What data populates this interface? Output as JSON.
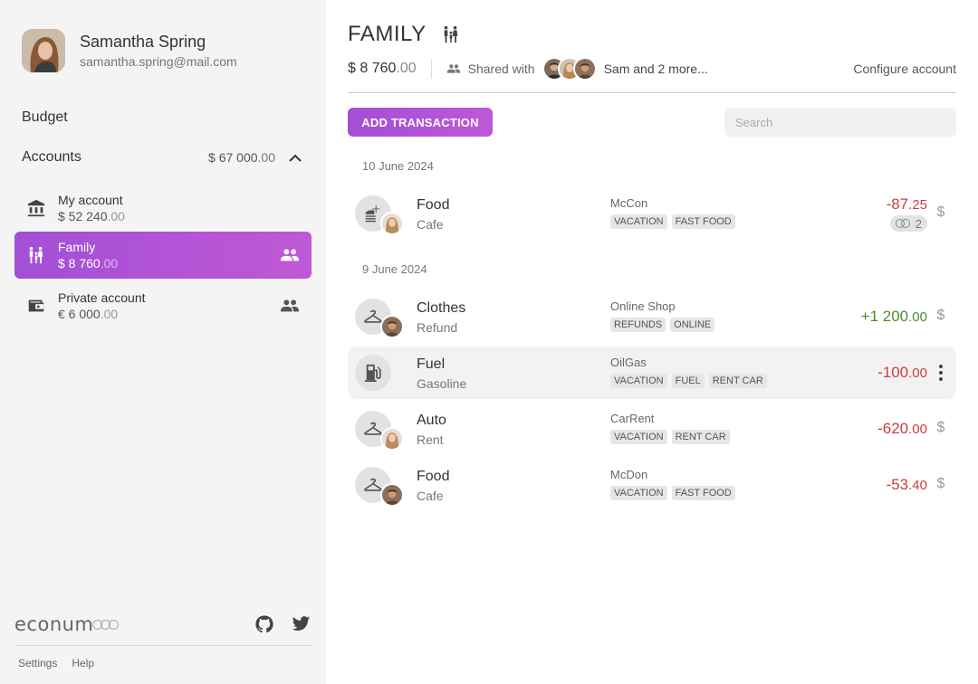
{
  "user": {
    "name": "Samantha Spring",
    "email": "samantha.spring@mail.com"
  },
  "nav": {
    "budget": "Budget",
    "accounts": "Accounts",
    "accounts_total_int": "$ 67 000",
    "accounts_total_dec": ".00"
  },
  "accounts": [
    {
      "name": "My account",
      "balance_int": "$ 52 240",
      "balance_dec": ".00",
      "icon": "bank-icon",
      "shared": false
    },
    {
      "name": "Family",
      "balance_int": "$ 8 760",
      "balance_dec": ".00",
      "icon": "family-icon",
      "shared": true,
      "active": true
    },
    {
      "name": "Private account",
      "balance_int": "€ 6 000",
      "balance_dec": ".00",
      "icon": "wallet-icon",
      "shared": true
    }
  ],
  "footer": {
    "logo": "econum",
    "settings": "Settings",
    "help": "Help"
  },
  "header": {
    "title": "FAMILY",
    "balance_int": "$ 8 760",
    "balance_dec": ".00",
    "shared_label": "Shared with",
    "shared_names": "Sam and 2 more...",
    "configure": "Configure account"
  },
  "toolbar": {
    "add_label": "ADD TRANSACTION",
    "search_placeholder": "Search"
  },
  "dates": [
    "10 June 2024",
    "9 June 2024"
  ],
  "transactions": [
    {
      "category": "Food",
      "sub": "Cafe",
      "merchant": "McCon",
      "tags": [
        "VACATION",
        "FAST FOOD"
      ],
      "amount_int": "-87",
      "amount_dec": ".25",
      "sign": "negative",
      "count": "2",
      "currency": "$",
      "icon": "food-icon"
    },
    {
      "category": "Clothes",
      "sub": "Refund",
      "merchant": "Online Shop",
      "tags": [
        "REFUNDS",
        "ONLINE"
      ],
      "amount_int": "+1 200",
      "amount_dec": ".00",
      "sign": "positive",
      "currency": "$",
      "icon": "hanger-icon"
    },
    {
      "category": "Fuel",
      "sub": "Gasoline",
      "merchant": "OilGas",
      "tags": [
        "VACATION",
        "FUEL",
        "RENT CAR"
      ],
      "amount_int": "-100",
      "amount_dec": ".00",
      "sign": "negative",
      "icon": "fuel-icon",
      "highlighted": true
    },
    {
      "category": "Auto",
      "sub": "Rent",
      "merchant": "CarRent",
      "tags": [
        "VACATION",
        "RENT CAR"
      ],
      "amount_int": "-620",
      "amount_dec": ".00",
      "sign": "negative",
      "currency": "$",
      "icon": "hanger-icon"
    },
    {
      "category": "Food",
      "sub": "Cafe",
      "merchant": "McDon",
      "tags": [
        "VACATION",
        "FAST FOOD"
      ],
      "amount_int": "-53",
      "amount_dec": ".40",
      "sign": "negative",
      "currency": "$",
      "icon": "hanger-icon"
    }
  ],
  "colors": {
    "accent": "#b054d6",
    "negative": "#d03b3b",
    "positive": "#4a8c2a"
  }
}
